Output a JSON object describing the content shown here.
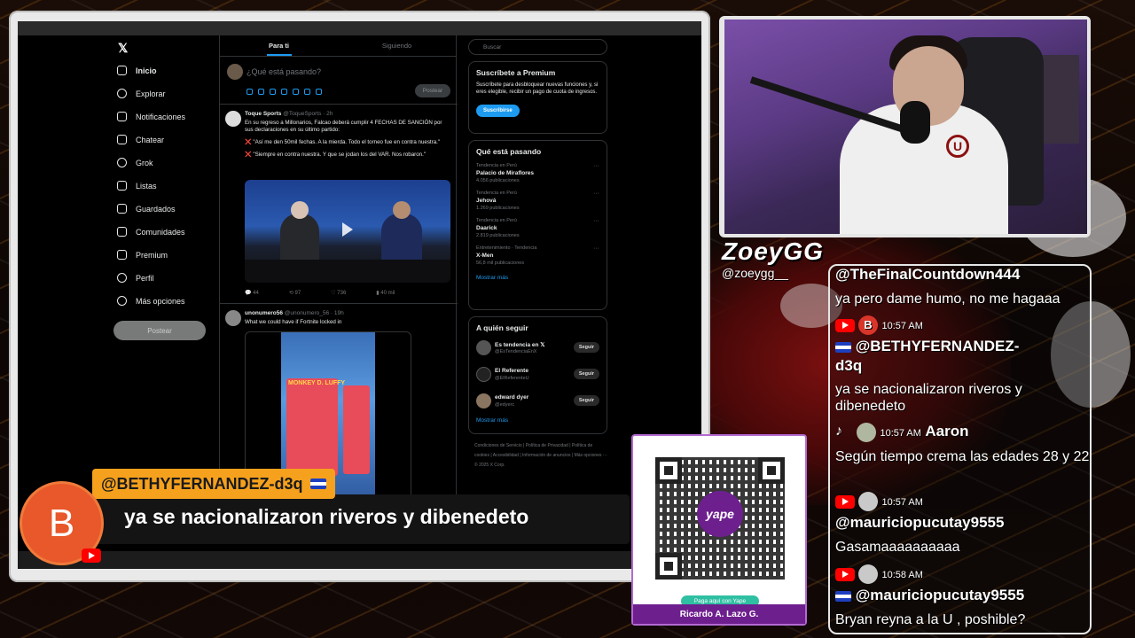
{
  "twitter": {
    "nav": [
      "Inicio",
      "Explorar",
      "Notificaciones",
      "Chatear",
      "Grok",
      "Listas",
      "Guardados",
      "Comunidades",
      "Premium",
      "Perfil",
      "Más opciones"
    ],
    "tabs": [
      "Para ti",
      "Siguiendo"
    ],
    "composer_placeholder": "¿Qué está pasando?",
    "post_button": "Postear",
    "tweet1": {
      "name": "Toque Sports",
      "handle": "@ToqueSports · 2h",
      "line1": "En su regreso a Millonarios, Falcao deberá cumplir 4 FECHAS DE SANCIÓN por sus declaraciones en su último partido:",
      "line2": "❌ \"Así me den 50mil fechas. A la mierda. Todo el torneo fue en contra nuestra.\"",
      "line3": "❌ \"Siempre en contra nuestra. Y que se jodan los del VAR. Nos robaron.\"",
      "replies": "44",
      "retweets": "97",
      "likes": "736",
      "views": "40 mil"
    },
    "tweet2": {
      "name": "unonumero56",
      "handle": "@unonumero_56 · 19h",
      "text": "What we could have if Fortnite locked in",
      "media_text": "MONKEY D. LUFFY"
    },
    "search_placeholder": "Buscar",
    "premium": {
      "title": "Suscríbete a Premium",
      "text": "Suscríbete para desbloquear nuevas funciones y, si eres elegible, recibir un pago de cuota de ingresos.",
      "button": "Suscribirse"
    },
    "trends_title": "Qué está pasando",
    "trends": [
      {
        "context": "Tendencia en Perú",
        "name": "Palacio de Miraflores",
        "count": "4.056 publicaciones"
      },
      {
        "context": "Tendencia en Perú",
        "name": "Jehová",
        "count": "1.269 publicaciones"
      },
      {
        "context": "Tendencia en Perú",
        "name": "Daarick",
        "count": "2.819 publicaciones"
      },
      {
        "context": "Entretenimiento · Tendencia",
        "name": "X-Men",
        "count": "56,8 mil publicaciones"
      }
    ],
    "show_more": "Mostrar más",
    "follow_title": "A quién seguir",
    "follows": [
      {
        "name": "Es tendencia en 𝕏",
        "handle": "@EsTendenciaEnX",
        "button": "Seguir"
      },
      {
        "name": "El Referente",
        "handle": "@ElReferenteU",
        "button": "Seguir"
      },
      {
        "name": "edward dyer",
        "handle": "@edyerc",
        "button": "Seguir"
      }
    ],
    "footer": "Condiciones de Servicio | Política de Privacidad | Política de cookies | Accesibilidad | Información de anuncios | Más opciones ··· © 2025 X Corp."
  },
  "alert": {
    "avatar_letter": "B",
    "username": "@BETHYFERNANDEZ-d3q",
    "message": "ya se nacionalizaron riveros y dibenedeto"
  },
  "stream": {
    "name": "ZoeyGG",
    "handle": "@zoeygg__"
  },
  "chat": [
    {
      "user": "@TheFinalCountdown444",
      "time": "",
      "message": "ya pero dame humo, no me hagaaa"
    },
    {
      "user": "@BETHYFERNANDEZ-d3q",
      "time": "10:57 AM",
      "message": "ya se nacionalizaron riveros y dibenedeto",
      "avatar": "B"
    },
    {
      "user": "Aaron",
      "time": "10:57 AM",
      "message": "Según tiempo crema las edades 28 y 22"
    },
    {
      "user": "@mauriciopucutay9555",
      "time": "10:57 AM",
      "message": "Gasamaaaaaaaaaa"
    },
    {
      "user": "@mauriciopucutay9555",
      "time": "10:58 AM",
      "message": "Bryan reyna a la U , poshible?"
    }
  ],
  "donation": {
    "brand": "yape",
    "pill": "Paga aquí con Yape",
    "name": "Ricardo A. Lazo G."
  },
  "colors": {
    "accent": "#1d9bf0",
    "alert": "#f6a11d",
    "yape": "#6e1f8e"
  }
}
